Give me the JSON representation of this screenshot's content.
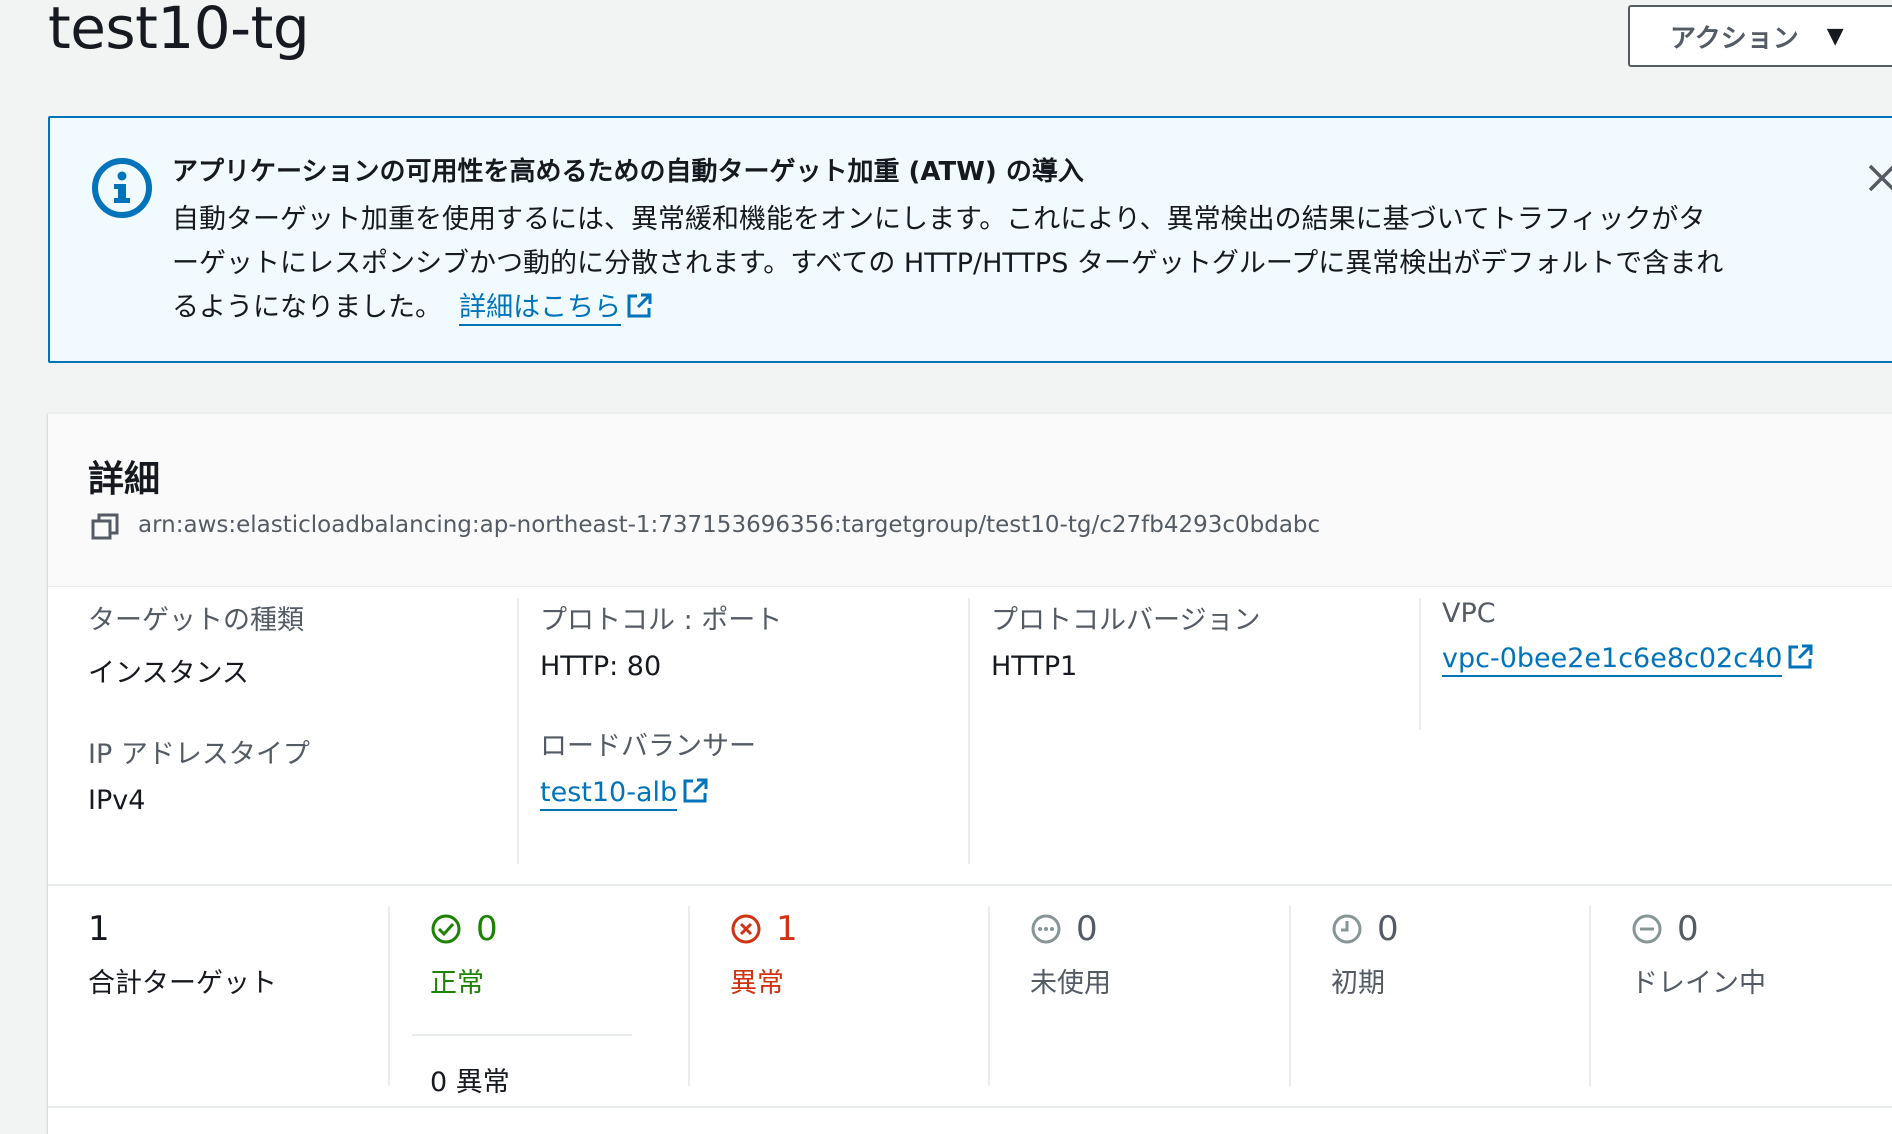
{
  "header": {
    "title": "test10-tg",
    "action_label": "アクション"
  },
  "flash": {
    "title": "アプリケーションの可用性を高めるための自動ターゲット加重 (ATW) の導入",
    "body_line1": "自動ターゲット加重を使用するには、異常緩和機能をオンにします。これにより、異常検出の結果に基づいてトラフィックがタ",
    "body_line2": "ーゲットにレスポンシブかつ動的に分散されます。すべての HTTP/HTTPS ターゲットグループに異常検出がデフォルトで含まれ",
    "body_line3": "るようになりました。",
    "link_label": "詳細はこちら"
  },
  "details": {
    "title": "詳細",
    "arn": "arn:aws:elasticloadbalancing:ap-northeast-1:737153696356:targetgroup/test10-tg/c27fb4293c0bdabc",
    "target_type_label": "ターゲットの種類",
    "target_type_value": "インスタンス",
    "ip_type_label": "IP アドレスタイプ",
    "ip_type_value": "IPv4",
    "protocol_port_label": "プロトコル : ポート",
    "protocol_port_value": "HTTP: 80",
    "load_balancer_label": "ロードバランサー",
    "load_balancer_value": "test10-alb",
    "protocol_version_label": "プロトコルバージョン",
    "protocol_version_value": "HTTP1",
    "vpc_label": "VPC",
    "vpc_value": "vpc-0bee2e1c6e8c02c40"
  },
  "stats": {
    "total_value": "1",
    "total_label": "合計ターゲット",
    "healthy_value": "0",
    "healthy_label": "正常",
    "healthy_sub": "0 異常",
    "unhealthy_value": "1",
    "unhealthy_label": "異常",
    "unused_value": "0",
    "unused_label": "未使用",
    "initial_value": "0",
    "initial_label": "初期",
    "draining_value": "0",
    "draining_label": "ドレイン中"
  },
  "colors": {
    "link": "#0073bb",
    "healthy": "#1d8102",
    "unhealthy": "#d13212",
    "neutral": "#687078"
  }
}
